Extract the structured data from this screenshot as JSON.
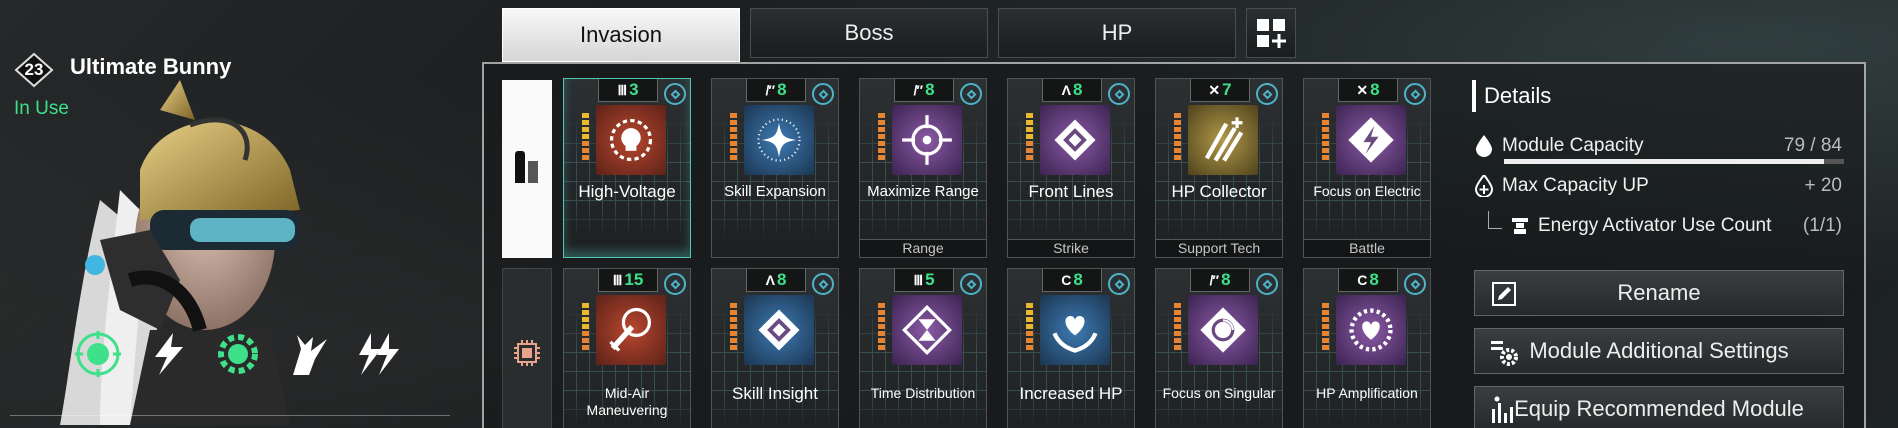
{
  "descendant": {
    "level": "23",
    "name": "Ultimate Bunny",
    "status": "In Use",
    "skill_icons": [
      "target-skull-icon",
      "lightning-bolt-icon",
      "gear-skull-icon",
      "bunny-sword-icon",
      "double-lightning-icon"
    ]
  },
  "tabs": [
    {
      "label": "Invasion",
      "active": true
    },
    {
      "label": "Boss",
      "active": false
    },
    {
      "label": "HP",
      "active": false
    }
  ],
  "add_preset_icon": "grid-plus-icon",
  "slot_tabs": [
    "ammo-icon",
    "chip-icon"
  ],
  "modules": [
    {
      "name": "High-Voltage",
      "cost": "3",
      "cost_symbol": "Ⅲ",
      "socket": "",
      "color": "red",
      "icon": "skull-burst-icon",
      "selected": true
    },
    {
      "name": "Skill Expansion",
      "cost": "8",
      "cost_symbol": "/″",
      "socket": "",
      "color": "blue",
      "icon": "star-ring-icon"
    },
    {
      "name": "Maximize Range",
      "cost": "8",
      "cost_symbol": "/″",
      "socket": "Range",
      "color": "purple",
      "icon": "crosshair-arrows-icon"
    },
    {
      "name": "Front Lines",
      "cost": "8",
      "cost_symbol": "Λ",
      "socket": "Strike",
      "color": "purple",
      "icon": "diamond-burst-icon"
    },
    {
      "name": "HP Collector",
      "cost": "7",
      "cost_symbol": "✕",
      "socket": "Support Tech",
      "color": "gold",
      "icon": "claw-plus-icon"
    },
    {
      "name": "Focus on Electric",
      "cost": "8",
      "cost_symbol": "✕",
      "socket": "Battle",
      "color": "purple",
      "icon": "electric-diamond-icon"
    },
    {
      "name": "Mid-Air Maneuvering",
      "cost": "15",
      "cost_symbol": "Ⅲ",
      "socket": "",
      "color": "red",
      "icon": "grapple-hook-icon"
    },
    {
      "name": "Skill Insight",
      "cost": "8",
      "cost_symbol": "Λ",
      "socket": "",
      "color": "blue",
      "icon": "diamond-burst-icon"
    },
    {
      "name": "Time Distribution",
      "cost": "5",
      "cost_symbol": "Ⅲ",
      "socket": "",
      "color": "purple",
      "icon": "hourglass-diamond-icon"
    },
    {
      "name": "Increased HP",
      "cost": "8",
      "cost_symbol": "C",
      "socket": "",
      "color": "blue",
      "icon": "heart-hands-icon"
    },
    {
      "name": "Focus on Singular",
      "cost": "8",
      "cost_symbol": "/″",
      "socket": "",
      "color": "purple",
      "icon": "singular-diamond-icon"
    },
    {
      "name": "HP Amplification",
      "cost": "8",
      "cost_symbol": "C",
      "socket": "",
      "color": "purple",
      "icon": "heart-burst-icon"
    }
  ],
  "details": {
    "title": "Details",
    "capacity_label": "Module Capacity",
    "capacity_value": "79 / 84",
    "capacity_used": 79,
    "capacity_max": 84,
    "max_up_label": "Max Capacity UP",
    "max_up_value": "+ 20",
    "activator_label": "Energy Activator Use Count",
    "activator_value": "(1/1)"
  },
  "buttons": {
    "rename": "Rename",
    "additional_settings": "Module Additional Settings",
    "equip_recommended": "Equip Recommended Module"
  }
}
